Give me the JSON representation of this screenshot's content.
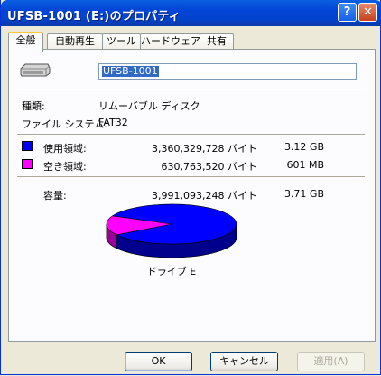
{
  "window": {
    "title": "UFSB-1001 (E:)のプロパティ"
  },
  "title_buttons": {
    "help": "?",
    "close": "✕"
  },
  "tabs": [
    {
      "label": "全般"
    },
    {
      "label": "自動再生"
    },
    {
      "label": "ツール"
    },
    {
      "label": "ハードウェア"
    },
    {
      "label": "共有"
    }
  ],
  "general": {
    "drive_name": "UFSB-1001",
    "type_label": "種類:",
    "type_value": "リムーバブル ディスク",
    "fs_label": "ファイル システム:",
    "fs_value": "FAT32",
    "used_label": "使用領域:",
    "used_bytes": "3,360,329,728 バイト",
    "used_size": "3.12 GB",
    "free_label": "空き領域:",
    "free_bytes": "630,763,520 バイト",
    "free_size": "601 MB",
    "capacity_label": "容量:",
    "capacity_bytes": "3,991,093,248 バイト",
    "capacity_size": "3.71 GB",
    "drive_label": "ドライブ E",
    "used_color": "#0000ff",
    "free_color": "#ff00ff",
    "used_fraction": 0.842
  },
  "buttons": {
    "ok": "OK",
    "cancel": "キャンセル",
    "apply": "適用(A)"
  }
}
